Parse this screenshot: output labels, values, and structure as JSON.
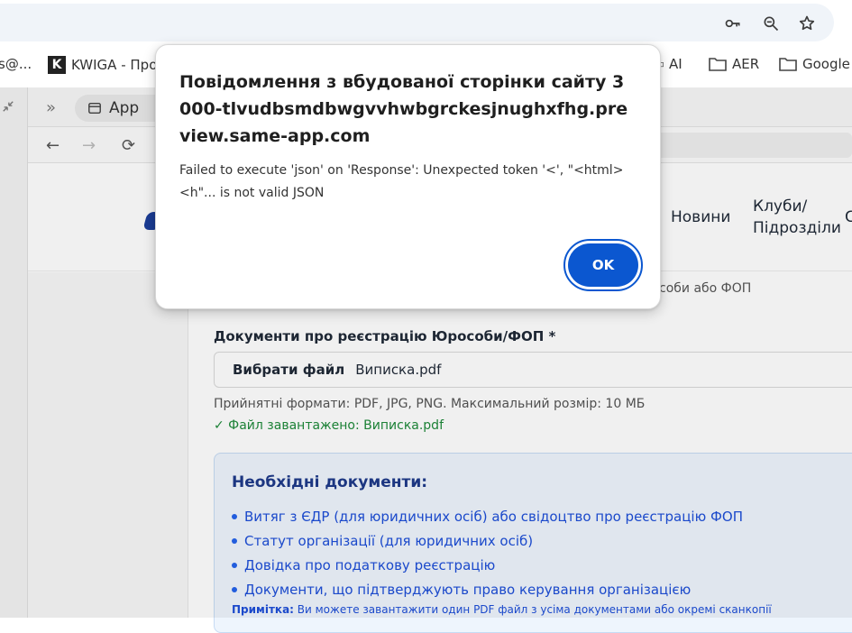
{
  "browser": {
    "bookmarks": [
      {
        "label": "s@..."
      },
      {
        "label": "KWIGA - Про"
      },
      {
        "label": "AI"
      },
      {
        "label": "AER"
      },
      {
        "label": "Google"
      }
    ],
    "app_tab_label": "App"
  },
  "site": {
    "nav": {
      "news": "Новини",
      "clubs_line1": "Клуби/",
      "clubs_line2": "Підрозділи",
      "cut": "С"
    },
    "form": {
      "field_note": "соби або ФОП",
      "doc_label": "Документи про реєстрацію Юрособи/ФОП *",
      "file_button": "Вибрати файл",
      "file_name": "Виписка.pdf",
      "formats": "Прийнятні формати: PDF, JPG, PNG. Максимальний розмір: 10 МБ",
      "uploaded": "✓ Файл завантажено: Виписка.pdf"
    },
    "required": {
      "title": "Необхідні документи:",
      "items": [
        "Витяг з ЄДР (для юридичних осіб) або свідоцтво про реєстрацію ФОП",
        "Статут організації (для юридичних осіб)",
        "Довідка про податкову реєстрацію",
        "Документи, що підтверджують право керування організацією"
      ],
      "note_label": "Примітка:",
      "note_text": " Ви можете завантажити один PDF файл з усіма документами або окремі сканкопії"
    }
  },
  "dialog": {
    "title": "Повідомлення з вбудованої сторінки сайту 3000-tlvudbsmdbwgvvhwbgrckesjnughxfhg.preview.same-app.com",
    "message": "Failed to execute 'json' on 'Response': Unexpected token '<', \"<html> <h\"... is not valid JSON",
    "ok_label": "OK"
  },
  "colors": {
    "accent": "#0b57d0",
    "success": "#1e8a3a",
    "info_text": "#1d4ed8",
    "info_bg": "#eef5fd"
  }
}
